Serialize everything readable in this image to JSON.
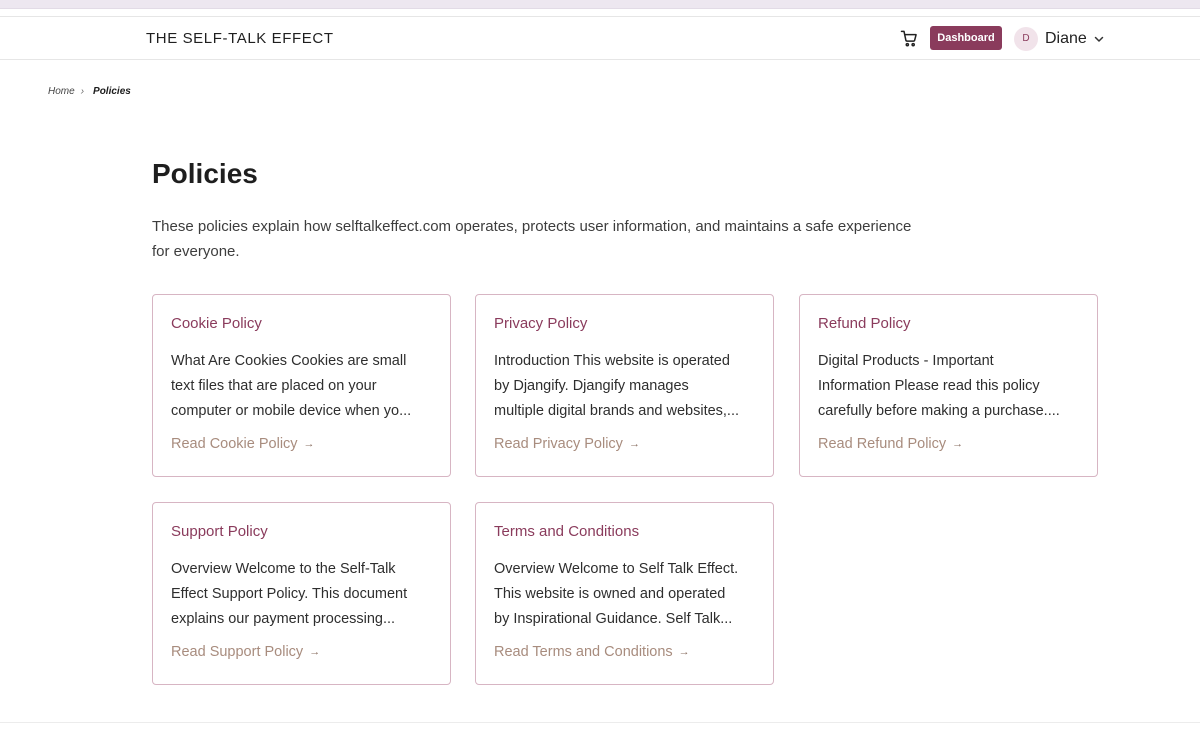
{
  "header": {
    "brand": "THE SELF-TALK EFFECT",
    "dashboard_label": "Dashboard",
    "user_initial": "D",
    "user_name": "Diane"
  },
  "breadcrumb": {
    "home": "Home",
    "separator": "›",
    "current": "Policies"
  },
  "page": {
    "title": "Policies",
    "intro": "These policies explain how selftalkeffect.com operates, protects user information, and maintains a safe experience for everyone."
  },
  "cards": [
    {
      "title": "Cookie Policy",
      "lines": [
        "What Are Cookies Cookies are small",
        "text files that are placed on your",
        "computer or mobile device when yo..."
      ],
      "link": "Read Cookie Policy"
    },
    {
      "title": "Privacy Policy",
      "lines": [
        "Introduction This website is operated",
        "by Djangify. Djangify manages",
        "multiple digital brands and websites,..."
      ],
      "link": "Read Privacy Policy"
    },
    {
      "title": "Refund Policy",
      "lines": [
        "Digital Products - Important",
        "Information Please read this policy",
        "carefully before making a purchase...."
      ],
      "link": "Read Refund Policy"
    },
    {
      "title": "Support Policy",
      "lines": [
        "Overview Welcome to the Self-Talk",
        "Effect Support Policy. This document",
        "explains our payment processing..."
      ],
      "link": "Read Support Policy"
    },
    {
      "title": "Terms and Conditions",
      "lines": [
        "Overview Welcome to Self Talk Effect.",
        "This website is owned and operated",
        "by Inspirational Guidance. Self Talk..."
      ],
      "link": "Read Terms and Conditions"
    }
  ],
  "link_arrow": "→",
  "colors": {
    "accent": "#8a3b5c",
    "link": "#a88c7e",
    "card_border": "#d7b5c3"
  },
  "icons": {
    "cart": "cart-icon",
    "chevron": "chevron-down-icon"
  }
}
